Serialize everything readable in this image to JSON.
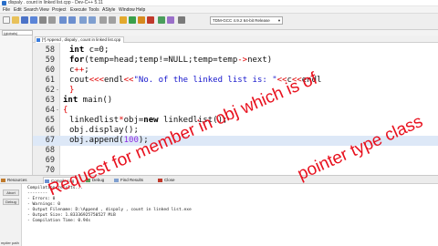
{
  "window": {
    "title": "dispaly . count in linked list.cpp - Dev-C++ 5.11"
  },
  "menu": [
    "File",
    "Edit",
    "Search",
    "View",
    "Project",
    "Execute",
    "Tools",
    "AStyle",
    "Window",
    "Help"
  ],
  "toolbar": {
    "compiler": "TDM-GCC 4.9.2 64-bit Release"
  },
  "class_browser": {
    "scope": "(globals)"
  },
  "editor": {
    "tab_label": "[*] Append , dispaly , count in linked list.cpp",
    "line_numbers": [
      "58",
      "59",
      "60",
      "61",
      "62",
      "63",
      "64",
      "65",
      "66",
      "67",
      "68",
      "69",
      "70"
    ],
    "lines": [
      "        int c=0;",
      "        for(temp=head;temp!=NULL;temp=temp->next)",
      "        c++;",
      "        cout<<<endl<<\"No. of the linked list is: \"<<c<<endl",
      "}",
      "int main()",
      "{",
      "        linkedlist*obj=new linkedlist();",
      "        obj.display();",
      "        obj.append(100);",
      "",
      "",
      ""
    ],
    "fold_markers": [
      "",
      "",
      "",
      "",
      "-",
      "",
      "-",
      "",
      "",
      "",
      "",
      "",
      ""
    ]
  },
  "annotation": {
    "line1": "Request for member in obj which is of",
    "line2": "pointer type class"
  },
  "bottom_tabs": [
    "Resources",
    "Compile Log",
    "Debug",
    "Find Results",
    "Close"
  ],
  "compile": {
    "buttons": [
      "Abort",
      "Debug"
    ],
    "side_label": "mpiler path",
    "log": [
      "Compilation results...",
      "--------",
      "- Errors: 0",
      "- Warnings: 0",
      "- Output Filename: D:\\Append , dispaly , count in linked list.exe",
      "- Output Size: 1.83336925750527 MiB",
      "- Compilation Time: 0.94s"
    ]
  },
  "colors": {
    "annotation_red": "#e8111e",
    "current_line": "#dde8f7",
    "symbol_red": "#e00000",
    "string_blue": "#1515cc"
  }
}
